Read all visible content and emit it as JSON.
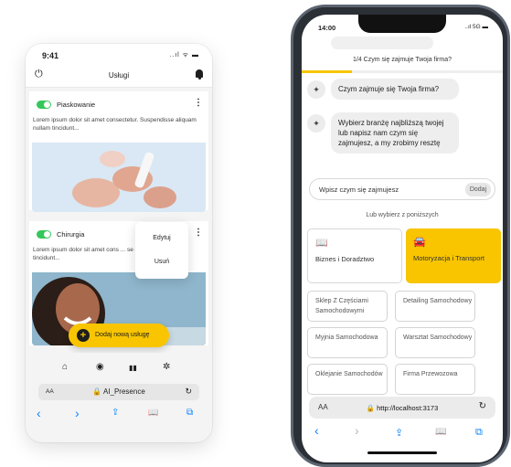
{
  "left_phone": {
    "time": "9:41",
    "signal": "..ıl ᯤ ▬",
    "title": "Usługi",
    "services": [
      {
        "name": "Piaskowanie",
        "description": "Lorem ipsum dolor sit amet consectetur. Suspendisse aliquam nullam tincidunt..."
      },
      {
        "name": "Chirurgia",
        "description": "Lorem ipsum dolor sit amet cons ... se aliquam nullam tincidunt..."
      }
    ],
    "context_menu": {
      "edit": "Edytuj",
      "delete": "Usuń"
    },
    "add_button": "Dodaj nową usługę",
    "url_bar": {
      "aa": "AA",
      "url": "🔒 AI_Presence",
      "reload": "↻"
    },
    "nav_icons": {
      "back": "‹",
      "forward": "›",
      "share": "⇪",
      "bookmarks": "📖",
      "tabs": "⧉"
    },
    "tab_icons": {
      "home": "⌂",
      "eye": "◉",
      "stats": "▮▮",
      "settings": "✲"
    },
    "colors": {
      "accent": "#f8c500",
      "toggle_on": "#34c759"
    }
  },
  "right_phone": {
    "time": "14:00",
    "signal": "..ıl 5G ▬",
    "step": "1/4 Czym się zajmuje Twoja firma?",
    "progress": 0.25,
    "messages": [
      "Czym zajmuje się Twoja firma?",
      "Wybierz branżę najbliższą twojej lub napisz nam czym się zajmujesz, a my zrobimy resztę"
    ],
    "input": {
      "placeholder": "Wpisz czym się zajmujesz",
      "button": "Dodaj"
    },
    "or_label": "Lub wybierz z poniższych",
    "categories": [
      {
        "label": "Biznes i Doradztwo",
        "icon": "book-icon",
        "selected": false
      },
      {
        "label": "Motoryzacja i Transport",
        "icon": "car-icon",
        "selected": true
      }
    ],
    "subcategories": [
      "Sklep Z Częściami Samochodowymi",
      "Detailing Samochodowy",
      "Myjnia Samochodowa",
      "Warsztat Samochodowy",
      "Oklejanie Samochodów",
      "Firma Przewozowa"
    ],
    "url_bar": {
      "aa": "AA",
      "url": "🔒 http://localhost:3173",
      "reload": "↻"
    },
    "nav_icons": {
      "back": "‹",
      "forward": "›",
      "share": "⇪",
      "bookmarks": "📖",
      "tabs": "⧉"
    }
  }
}
